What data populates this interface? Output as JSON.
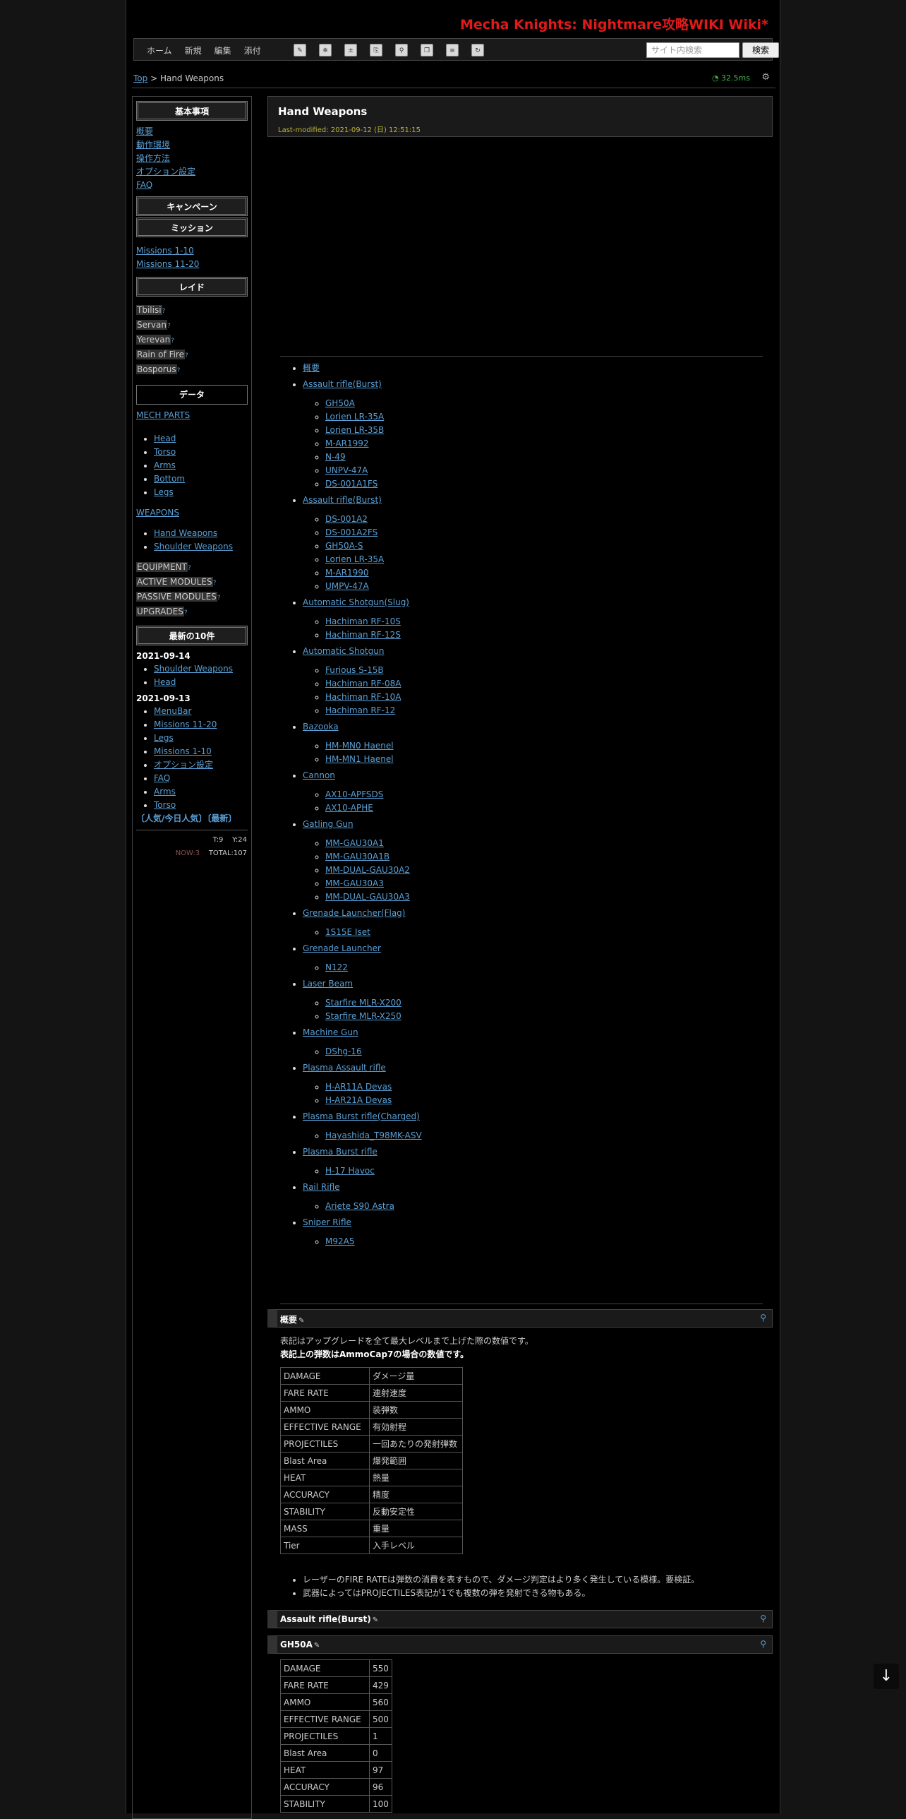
{
  "site_title": "Mecha Knights: Nightmare攻略WIKI Wiki*",
  "menu": [
    "ホーム",
    "新規",
    "編集",
    "添付"
  ],
  "toolbar_icons": [
    "edit-icon",
    "freeze-icon",
    "diff-icon",
    "backup-icon",
    "attach-icon",
    "copy-icon",
    "rename-icon",
    "reload-icon"
  ],
  "search": {
    "placeholder": "サイト内検索",
    "button": "検索"
  },
  "breadcrumb": {
    "top": "Top",
    "sep": " > ",
    "current": "Hand Weapons"
  },
  "timing": "32.5ms",
  "page": {
    "title": "Hand Weapons",
    "last_modified": "Last-modified: 2021-09-12 (日) 12:51:15"
  },
  "sidebar": {
    "basics_header": "基本事項",
    "basics": [
      "概要",
      "動作環境",
      "操作方法",
      "オプション設定",
      "FAQ"
    ],
    "campaign_header": "キャンペーン",
    "mission_header": "ミッション",
    "missions": [
      "Missions 1-10",
      "Missions 11-20"
    ],
    "raid_header": "レイド",
    "raids": [
      "Tbilisi",
      "Servan",
      "Yerevan",
      "Rain of Fire",
      "Bosporus"
    ],
    "data_header": "データ",
    "mech_parts": "MECH PARTS",
    "parts": [
      "Head",
      "Torso",
      "Arms",
      "Bottom",
      "Legs"
    ],
    "weapons": "WEAPONS",
    "weapon_types": [
      "Hand Weapons",
      "Shoulder Weapons"
    ],
    "misc": [
      "EQUIPMENT",
      "ACTIVE MODULES",
      "PASSIVE MODULES",
      "UPGRADES"
    ],
    "recent_header": "最新の10件",
    "recent": [
      {
        "date": "2021-09-14",
        "items": [
          "Shoulder Weapons",
          "Head"
        ]
      },
      {
        "date": "2021-09-13",
        "items": [
          "MenuBar",
          "Missions 11-20",
          "Legs",
          "Missions 1-10",
          "オプション設定",
          "FAQ",
          "Arms",
          "Torso"
        ]
      }
    ],
    "popular": "〔人気/今日人気〕〔最新〕",
    "counter": {
      "t": "T:9",
      "y": "Y:24",
      "now": "NOW:3",
      "total": "TOTAL:107"
    }
  },
  "toc": [
    {
      "label": "概要",
      "items": []
    },
    {
      "label": "Assault rifle(Burst)",
      "items": [
        "GH50A",
        "Lorien LR-35A",
        "Lorien LR-35B",
        "M-AR1992",
        "N-49",
        "UNPV-47A",
        "DS-001A1FS"
      ]
    },
    {
      "label": "Assault rifle(Burst)",
      "items": [
        "DS-001A2",
        "DS-001A2FS",
        "GH50A-S",
        "Lorien LR-35A",
        "M-AR1990",
        "UMPV-47A"
      ]
    },
    {
      "label": "Automatic Shotgun(Slug)",
      "items": [
        "Hachiman RF-10S",
        "Hachiman RF-12S"
      ]
    },
    {
      "label": "Automatic Shotgun",
      "items": [
        "Furious S-15B",
        "Hachiman RF-08A",
        "Hachiman RF-10A",
        "Hachiman RF-12"
      ]
    },
    {
      "label": "Bazooka",
      "items": [
        "HM-MN0 Haenel",
        "HM-MN1 Haenel"
      ]
    },
    {
      "label": "Cannon",
      "items": [
        "AX10-APFSDS",
        "AX10-APHE"
      ]
    },
    {
      "label": "Gatling Gun",
      "items": [
        "MM-GAU30A1",
        "MM-GAU30A1B",
        "MM-DUAL-GAU30A2",
        "MM-GAU30A3",
        "MM-DUAL-GAU30A3"
      ]
    },
    {
      "label": "Grenade Launcher(Flag)",
      "items": [
        "1S15E Iset"
      ]
    },
    {
      "label": "Grenade Launcher",
      "items": [
        "N122"
      ]
    },
    {
      "label": "Laser Beam",
      "items": [
        "Starfire MLR-X200",
        "Starfire MLR-X250"
      ]
    },
    {
      "label": "Machine Gun",
      "items": [
        "DShg-16"
      ]
    },
    {
      "label": "Plasma Assault rifle",
      "items": [
        "H-AR11A Devas",
        "H-AR21A Devas"
      ]
    },
    {
      "label": "Plasma Burst rifle(Charged)",
      "items": [
        "Hayashida_T98MK-ASV"
      ]
    },
    {
      "label": "Plasma Burst rifle",
      "items": [
        "H-17 Havoc"
      ]
    },
    {
      "label": "Rail Rifle",
      "items": [
        "Ariete S90 Astra"
      ]
    },
    {
      "label": "Sniper Rifle",
      "items": [
        "M92A5"
      ]
    }
  ],
  "overview": {
    "heading": "概要",
    "note1": "表記はアップグレードを全て最大レベルまで上げた際の数値です。",
    "note2": "表記上の弾数はAmmoCap7の場合の数値です。",
    "rows": [
      [
        "DAMAGE",
        "ダメージ量"
      ],
      [
        "FARE RATE",
        "連射速度"
      ],
      [
        "AMMO",
        "装弾数"
      ],
      [
        "EFFECTIVE RANGE",
        "有効射程"
      ],
      [
        "PROJECTILES",
        "一回あたりの発射弾数"
      ],
      [
        "Blast Area",
        "爆発範囲"
      ],
      [
        "HEAT",
        "熱量"
      ],
      [
        "ACCURACY",
        "精度"
      ],
      [
        "STABILITY",
        "反動安定性"
      ],
      [
        "MASS",
        "重量"
      ],
      [
        "Tier",
        "入手レベル"
      ]
    ],
    "bullets": [
      "レーザーのFIRE RATEは弾数の消費を表すもので、ダメージ判定はより多く発生している模様。要検証。",
      "武器によってはPROJECTILES表記が1でも複数の弾を発射できる物もある。"
    ]
  },
  "section_burst": "Assault rifle(Burst)",
  "gh50a": {
    "heading": "GH50A",
    "rows": [
      [
        "DAMAGE",
        "550"
      ],
      [
        "FARE RATE",
        "429"
      ],
      [
        "AMMO",
        "560"
      ],
      [
        "EFFECTIVE RANGE",
        "500"
      ],
      [
        "PROJECTILES",
        "1"
      ],
      [
        "Blast Area",
        "0"
      ],
      [
        "HEAT",
        "97"
      ],
      [
        "ACCURACY",
        "96"
      ],
      [
        "STABILITY",
        "100"
      ]
    ]
  }
}
